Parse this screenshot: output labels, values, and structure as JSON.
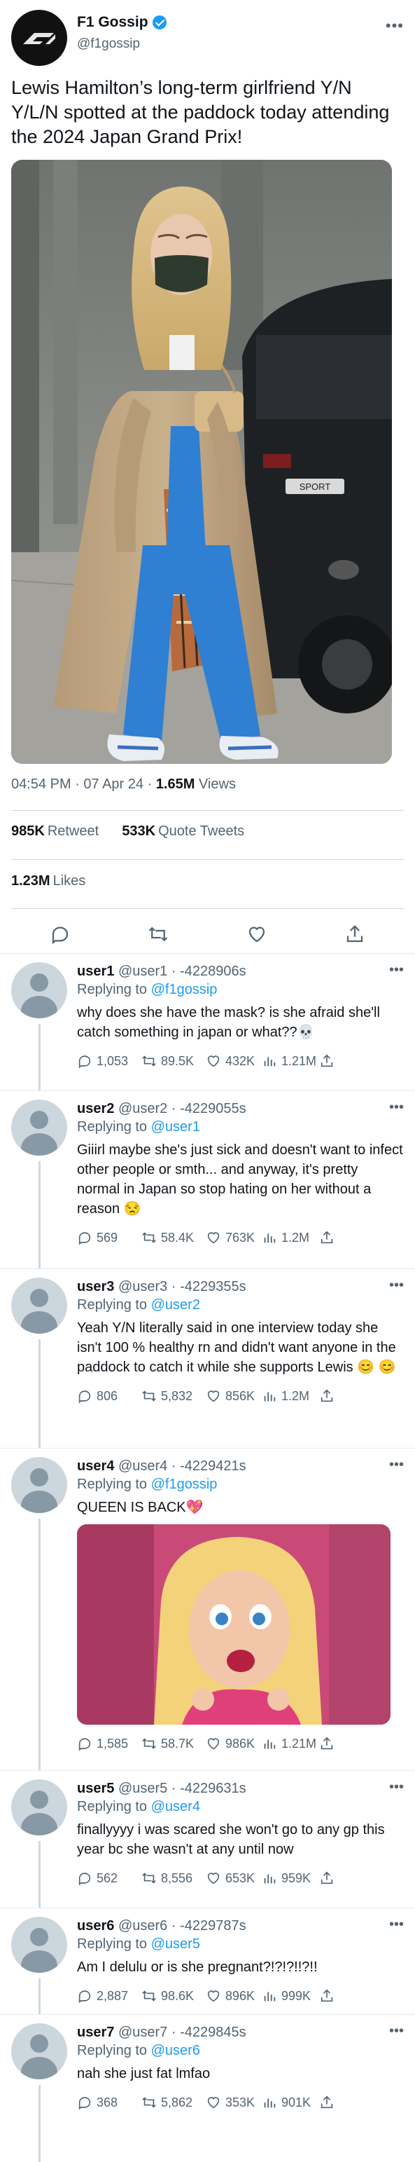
{
  "post": {
    "account_name": "F1 Gossip",
    "handle": "@f1gossip",
    "text": "Lewis Hamilton’s long-term girlfriend Y/N Y/L/N spotted at the paddock today attending the 2024 Japan Grand Prix!",
    "time": "04:54 PM",
    "date_sep": " · ",
    "date": "07 Apr 24",
    "views_count": "1.65M",
    "views_label": "Views",
    "retweets_count": "985K",
    "retweets_label": "Retweet",
    "quotes_count": "533K",
    "quotes_label": "Quote Tweets",
    "likes_count": "1.23M",
    "likes_label": "Likes",
    "car_badge": "SPORT"
  },
  "replies": [
    {
      "user": "user1",
      "handle": "@user1",
      "id": "-4228906s",
      "replying_to": "@f1gossip",
      "text": "why does she have the mask? is she afraid she'll catch something in japan or what??💀",
      "replies": "1,053",
      "retweets": "89.5K",
      "likes": "432K",
      "views": "1.21M"
    },
    {
      "user": "user2",
      "handle": "@user2",
      "id": "-4229055s",
      "replying_to": "@user1",
      "text": "Giiirl maybe she's just sick and doesn't want to infect other people or smth... and anyway, it's pretty normal in Japan so stop hating on her without a reason 😒",
      "replies": "569",
      "retweets": "58.4K",
      "likes": "763K",
      "views": "1.2M"
    },
    {
      "user": "user3",
      "handle": "@user3",
      "id": "-4229355s",
      "replying_to": "@user2",
      "text": "Yeah Y/N literally said in one interview today she isn't 100 % healthy rn and didn't want anyone in the paddock to catch it while she supports Lewis 😊 😊",
      "replies": "806",
      "retweets": "5,832",
      "likes": "856K",
      "views": "1.2M"
    },
    {
      "user": "user4",
      "handle": "@user4",
      "id": "-4229421s",
      "replying_to": "@f1gossip",
      "text": "QUEEN IS BACK💖",
      "replies": "1,585",
      "retweets": "58.7K",
      "likes": "986K",
      "views": "1.21M"
    },
    {
      "user": "user5",
      "handle": "@user5",
      "id": "-4229631s",
      "replying_to": "@user4",
      "text": "finallyyyy i was scared she won't go to any gp this year bc she wasn't at any until now",
      "replies": "562",
      "retweets": "8,556",
      "likes": "653K",
      "views": "959K"
    },
    {
      "user": "user6",
      "handle": "@user6",
      "id": "-4229787s",
      "replying_to": "@user5",
      "text": "Am I delulu or is she pregnant?!?!?!!?!!",
      "replies": "2,887",
      "retweets": "98.6K",
      "likes": "896K",
      "views": "999K"
    },
    {
      "user": "user7",
      "handle": "@user7",
      "id": "-4229845s",
      "replying_to": "@user6",
      "text": "nah she just fat lmfao",
      "replies": "368",
      "retweets": "5,862",
      "likes": "353K",
      "views": "901K"
    }
  ],
  "labels": {
    "replying_prefix": "Replying to ",
    "dot_sep": " · "
  },
  "colors": {
    "accent": "#1d9bf0",
    "secondary_text": "#536471",
    "divider": "#cfd9de"
  },
  "icons": [
    "verified-icon",
    "more-icon",
    "reply-icon",
    "retweet-icon",
    "like-icon",
    "share-icon",
    "views-icon"
  ]
}
